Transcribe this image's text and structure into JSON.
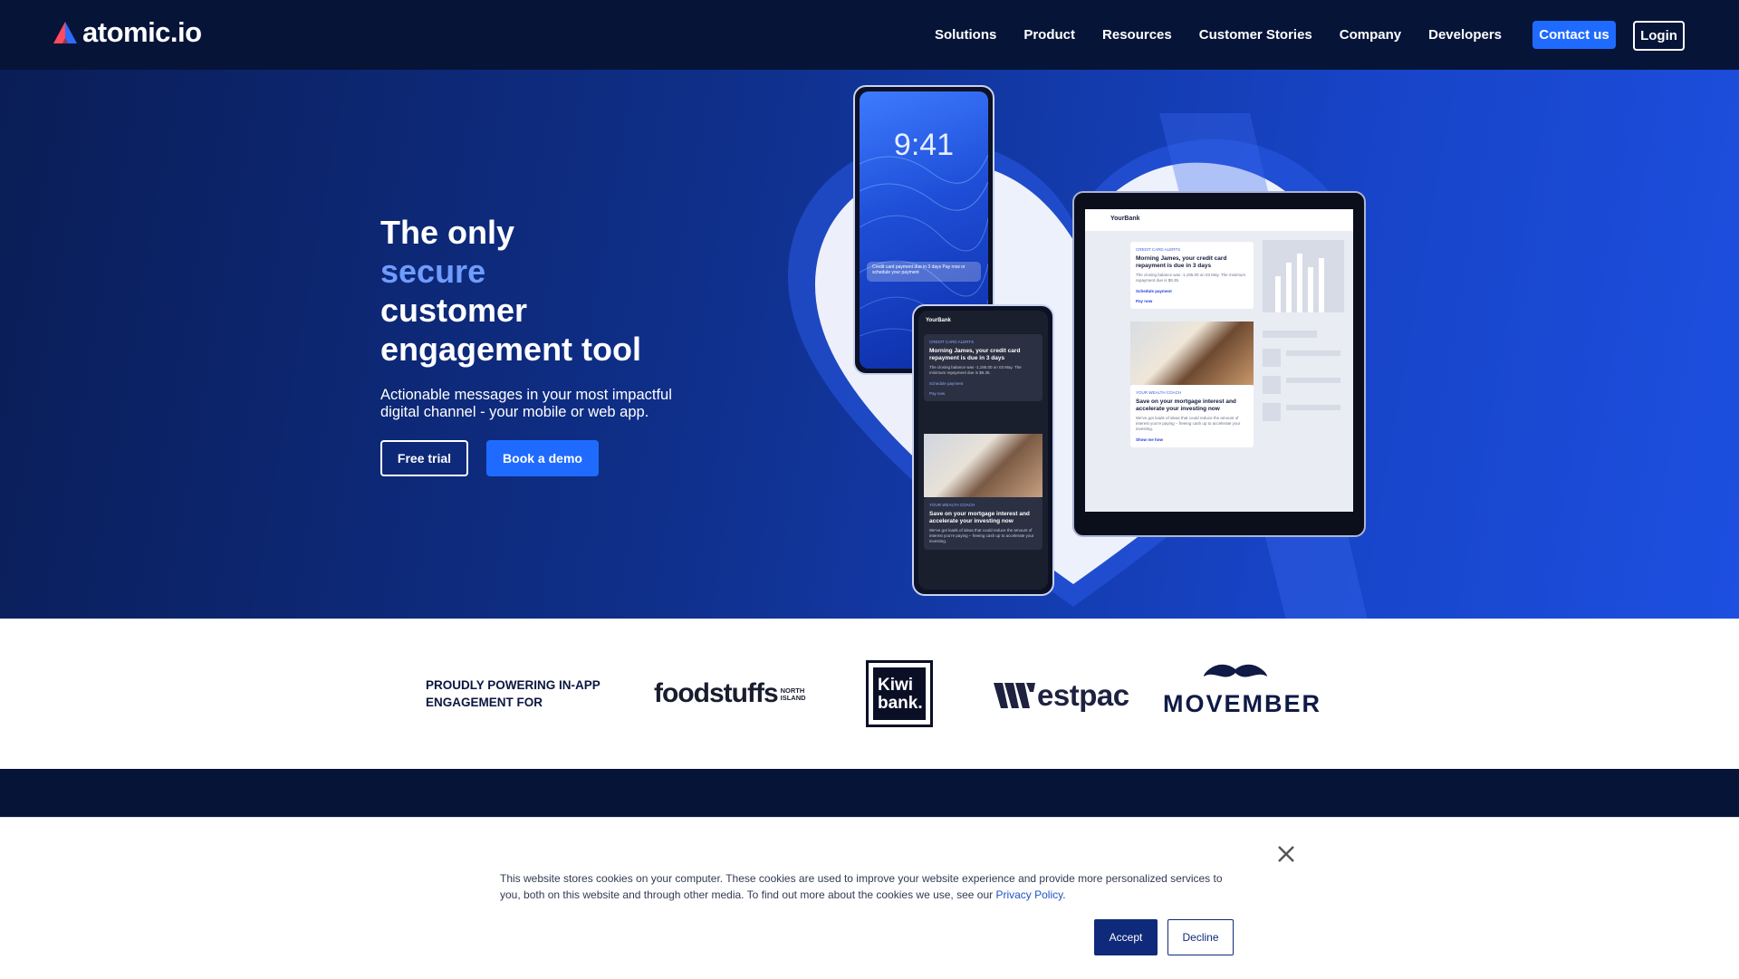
{
  "brand": {
    "name": "atomic.io"
  },
  "nav": {
    "links": [
      "Solutions",
      "Product",
      "Resources",
      "Customer Stories",
      "Company",
      "Developers"
    ],
    "contact_label": "Contact us",
    "login_label": "Login"
  },
  "hero": {
    "title_line1": "The only",
    "title_accent": "secure",
    "title_line3": "customer",
    "title_line4": "engagement tool",
    "subtitle": "Actionable messages in your most impactful digital channel - your mobile or web app.",
    "free_trial_label": "Free trial",
    "book_demo_label": "Book a demo",
    "phone_time": "9:41",
    "phone_notification": "Credit card payment due in 3 days\nPay now or schedule your payment",
    "app_name": "YourBank",
    "card1_tag": "CREDIT CARD ALERTS",
    "card1_title": "Morning James, your credit card repayment is due in 3 days",
    "card1_body": "The closing balance was -1,195.00 on 03 May. The minimum repayment due is $9.35.",
    "card1_link1": "Schedule payment",
    "card1_link2": "Pay now",
    "card2_tag": "YOUR WEALTH COACH",
    "card2_title": "Save on your mortgage interest and accelerate your investing now",
    "card2_body": "We've got loads of ideas that could reduce the amount of interest you're paying – freeing cash up to accelerate your investing.",
    "card2_link": "Show me how"
  },
  "logos": {
    "label": "PROUDLY POWERING IN-APP ENGAGEMENT FOR",
    "foodstuffs": "foodstuffs",
    "foodstuffs_sub1": "NORTH",
    "foodstuffs_sub2": "ISLAND",
    "kiwibank_line1": "Kiwi",
    "kiwibank_line2": "bank.",
    "westpac": "estpac",
    "movember": "MOVEMBER"
  },
  "cookie": {
    "message": "This website stores cookies on your computer. These cookies are used to improve your website experience and provide more personalized services to you, both on this website and through other media. To find out more about the cookies we use, see our ",
    "privacy_link": "Privacy Policy",
    "period": ".",
    "accept_label": "Accept",
    "decline_label": "Decline"
  },
  "colors": {
    "nav_bg": "#061438",
    "accent": "#1f6bff",
    "hero_accent_text": "#6f9cff",
    "accept_bg": "#0f2a7a"
  },
  "icons": [
    "atomic-logo-icon",
    "close-icon",
    "play-icon",
    "calendar-icon"
  ]
}
